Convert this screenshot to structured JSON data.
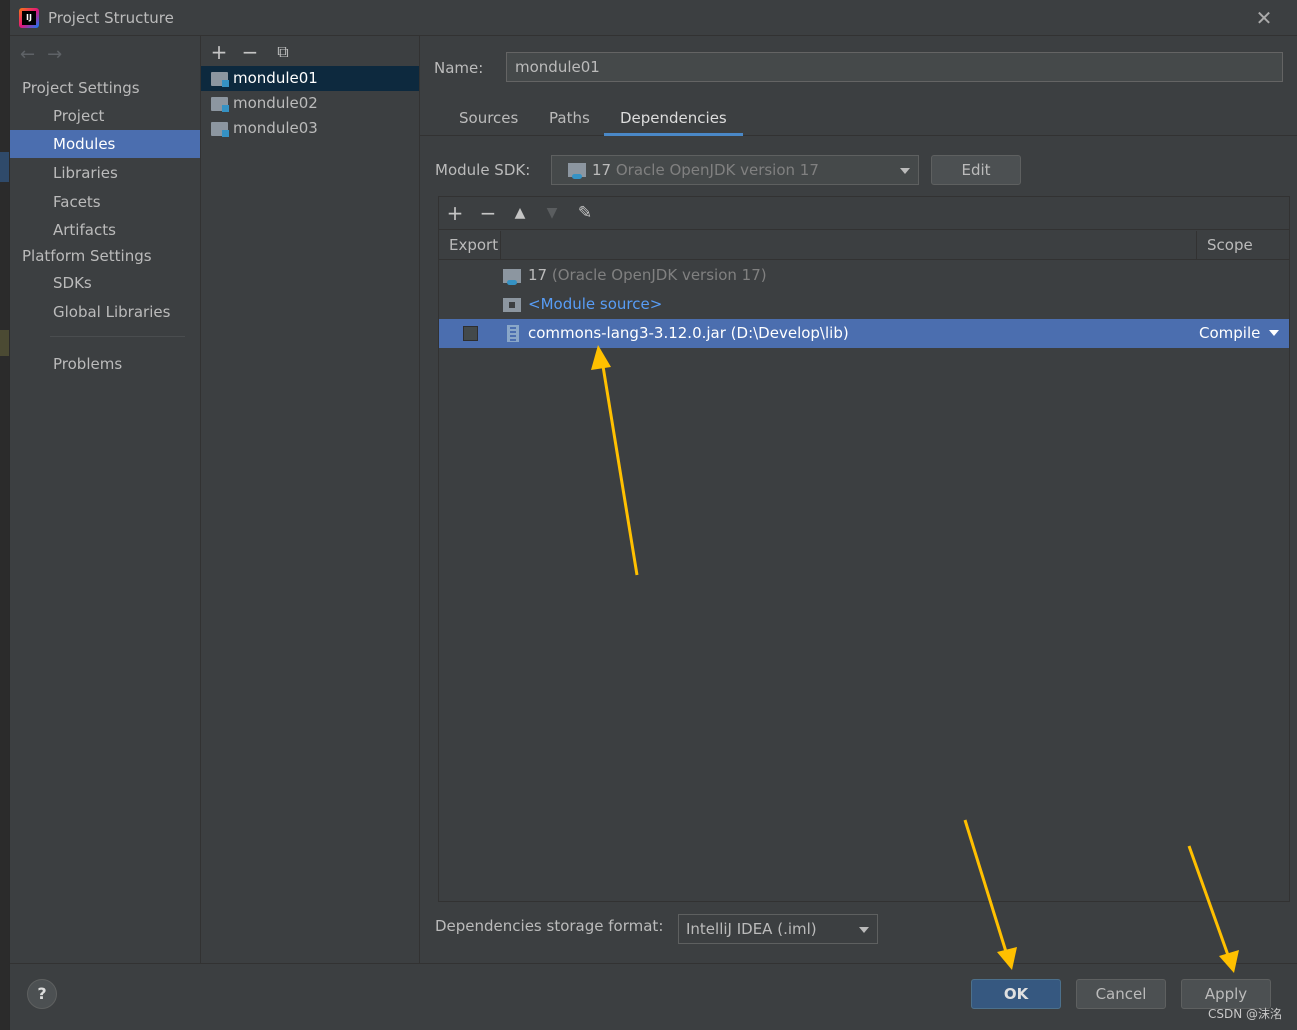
{
  "window": {
    "title": "Project Structure"
  },
  "nav": {
    "project_settings_header": "Project Settings",
    "platform_settings_header": "Platform Settings",
    "items": [
      {
        "label": "Project"
      },
      {
        "label": "Modules"
      },
      {
        "label": "Libraries"
      },
      {
        "label": "Facets"
      },
      {
        "label": "Artifacts"
      },
      {
        "label": "SDKs"
      },
      {
        "label": "Global Libraries"
      },
      {
        "label": "Problems"
      }
    ]
  },
  "modules": [
    {
      "label": "mondule01"
    },
    {
      "label": "mondule02"
    },
    {
      "label": "mondule03"
    }
  ],
  "detail": {
    "name_label": "Name:",
    "name_value": "mondule01",
    "tabs": [
      {
        "label": "Sources"
      },
      {
        "label": "Paths"
      },
      {
        "label": "Dependencies"
      }
    ],
    "sdk_label": "Module SDK:",
    "sdk_version": "17",
    "sdk_name": "Oracle OpenJDK version 17",
    "edit_label": "Edit",
    "table_headers": {
      "export": "Export",
      "scope": "Scope"
    },
    "rows": [
      {
        "name": "17",
        "detail": "(Oracle OpenJDK version 17)"
      },
      {
        "name": "<Module source>"
      },
      {
        "name": "commons-lang3-3.12.0.jar (D:\\Develop\\lib)",
        "scope": "Compile",
        "export": false
      }
    ],
    "storage_label": "Dependencies storage format:",
    "storage_value": "IntelliJ IDEA (.iml)"
  },
  "buttons": {
    "ok": "OK",
    "cancel": "Cancel",
    "apply": "Apply",
    "help": "?"
  },
  "watermark": "CSDN @沫洺",
  "colors": {
    "accent": "#4b6eaf",
    "annotation_arrow": "#ffc000",
    "link": "#589df6"
  }
}
